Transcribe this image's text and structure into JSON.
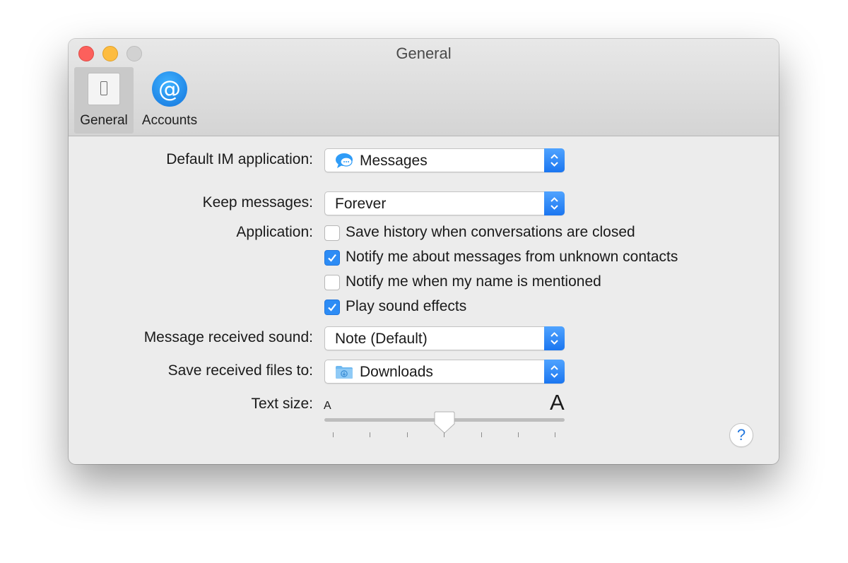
{
  "window": {
    "title": "General"
  },
  "toolbar": {
    "items": [
      {
        "label": "General",
        "icon": "switch-icon",
        "selected": true
      },
      {
        "label": "Accounts",
        "icon": "at-sign-icon",
        "selected": false
      }
    ]
  },
  "settings": {
    "default_im": {
      "label": "Default IM application:",
      "value": "Messages",
      "icon": "messages-icon"
    },
    "keep_messages": {
      "label": "Keep messages:",
      "value": "Forever"
    },
    "application": {
      "label": "Application:",
      "options": [
        {
          "label": "Save history when conversations are closed",
          "checked": false
        },
        {
          "label": "Notify me about messages from unknown contacts",
          "checked": true
        },
        {
          "label": "Notify me when my name is mentioned",
          "checked": false
        },
        {
          "label": "Play sound effects",
          "checked": true
        }
      ]
    },
    "received_sound": {
      "label": "Message received sound:",
      "value": "Note (Default)"
    },
    "save_files": {
      "label": "Save received files to:",
      "value": "Downloads",
      "icon": "downloads-folder-icon"
    },
    "text_size": {
      "label": "Text size:",
      "small_label": "A",
      "large_label": "A",
      "level": 3,
      "steps": 7
    }
  },
  "help": {
    "label": "?"
  },
  "colors": {
    "accent": "#2d8cf5",
    "close": "#fc605c",
    "minimize": "#fdbc40"
  }
}
